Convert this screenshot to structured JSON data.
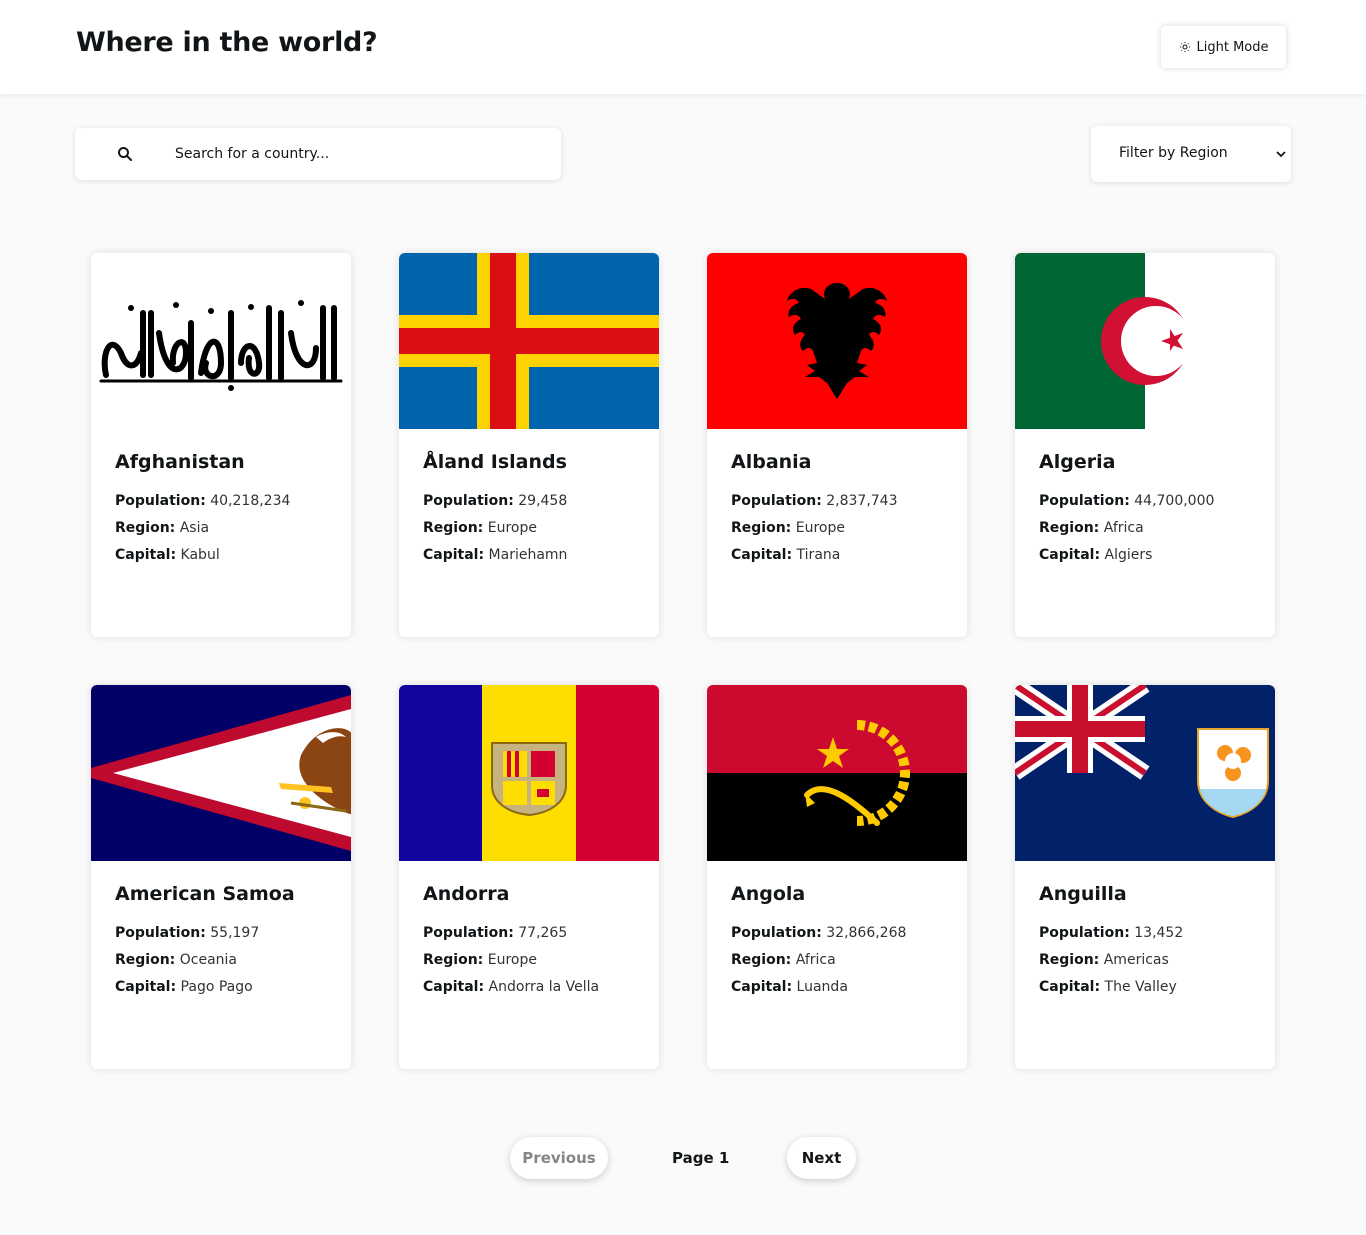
{
  "header": {
    "title": "Where in the world?",
    "mode_label": "Light Mode",
    "mode_icon": "sun-icon"
  },
  "search": {
    "placeholder": "Search for a country...",
    "value": "",
    "icon": "search-icon"
  },
  "filter": {
    "label": "Filter by Region",
    "icon": "chevron-down-icon"
  },
  "labels": {
    "population": "Population:",
    "region": "Region:",
    "capital": "Capital:"
  },
  "countries": [
    {
      "name": "Afghanistan",
      "population": "40,218,234",
      "region": "Asia",
      "capital": "Kabul"
    },
    {
      "name": "Åland Islands",
      "population": "29,458",
      "region": "Europe",
      "capital": "Mariehamn"
    },
    {
      "name": "Albania",
      "population": "2,837,743",
      "region": "Europe",
      "capital": "Tirana"
    },
    {
      "name": "Algeria",
      "population": "44,700,000",
      "region": "Africa",
      "capital": "Algiers"
    },
    {
      "name": "American Samoa",
      "population": "55,197",
      "region": "Oceania",
      "capital": "Pago Pago"
    },
    {
      "name": "Andorra",
      "population": "77,265",
      "region": "Europe",
      "capital": "Andorra la Vella"
    },
    {
      "name": "Angola",
      "population": "32,866,268",
      "region": "Africa",
      "capital": "Luanda"
    },
    {
      "name": "Anguilla",
      "population": "13,452",
      "region": "Americas",
      "capital": "The Valley"
    }
  ],
  "pagination": {
    "previous": "Previous",
    "page_label": "Page 1",
    "next": "Next"
  },
  "colors": {
    "background": "#fafafa",
    "surface": "#ffffff",
    "text": "#111517",
    "muted": "#858585"
  }
}
